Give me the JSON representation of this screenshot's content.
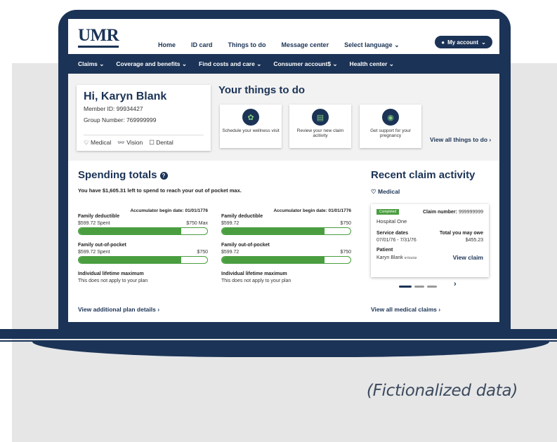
{
  "header": {
    "logo": "UMR",
    "nav": [
      "Home",
      "ID card",
      "Things to do",
      "Message center",
      "Select language"
    ],
    "account": "My account"
  },
  "main_nav": [
    "Claims",
    "Coverage and benefits",
    "Find costs and care",
    "Consumer account$",
    "Health center"
  ],
  "member": {
    "greeting": "Hi, Karyn Blank",
    "member_id": "Member ID: 99934427",
    "group_number": "Group Number: 769999999",
    "coverages": [
      "Medical",
      "Vision",
      "Dental"
    ]
  },
  "things_to_do": {
    "title": "Your things to do",
    "cards": [
      {
        "label": "Schedule your wellness visit",
        "icon": "wellness-icon"
      },
      {
        "label": "Review your new claim acitivity",
        "icon": "clipboard-icon"
      },
      {
        "label": "Get support for your pregnancy",
        "icon": "support-icon"
      }
    ],
    "view_all": "View all things to do"
  },
  "spending": {
    "title": "Spending totals",
    "subtitle": "You have $1,605.31 left to spend to reach your out of pocket max.",
    "columns": [
      {
        "accumulator": "Accumulator begin date: 01/01/1776",
        "deductible_label": "Family deductible",
        "deductible_spent": "$599.72 Spent",
        "deductible_max": "$750 Max",
        "deductible_progress": 0.8,
        "oop_label": "Family out-of-pocket",
        "oop_spent": "$599.72 Spent",
        "oop_max": "$750",
        "oop_progress": 0.8,
        "lifetime_label": "Individual lifetime maximum",
        "lifetime_note": "This does not apply to your plan"
      },
      {
        "accumulator": "Accumulator begin date: 01/01/1776",
        "deductible_label": "Family deductible",
        "deductible_spent": "$599.72",
        "deductible_max": "$750",
        "deductible_progress": 0.8,
        "oop_label": "Family out-of-pocket",
        "oop_spent": "$599.72",
        "oop_max": "$750",
        "oop_progress": 0.8,
        "lifetime_label": "Individual lifetime maximum",
        "lifetime_note": "This does not apply to your plan"
      }
    ],
    "view_plan": "View additional plan details"
  },
  "recent": {
    "title": "Recent claim activity",
    "category": "Medical",
    "claim": {
      "status": "Completed",
      "number_label": "Claim number:",
      "number": "999999999",
      "provider": "Hospital One",
      "dates_label": "Service dates",
      "dates": "07/01/76 - 7/31/76",
      "owe_label": "Total you may owe",
      "owe": "$455.23",
      "patient_label": "Patient",
      "patient": "Karyn Blank",
      "patient_dob": "07/21/02",
      "view": "View claim"
    },
    "view_all": "View all medical claims"
  },
  "disclaimer": "(Fictionalized data)"
}
